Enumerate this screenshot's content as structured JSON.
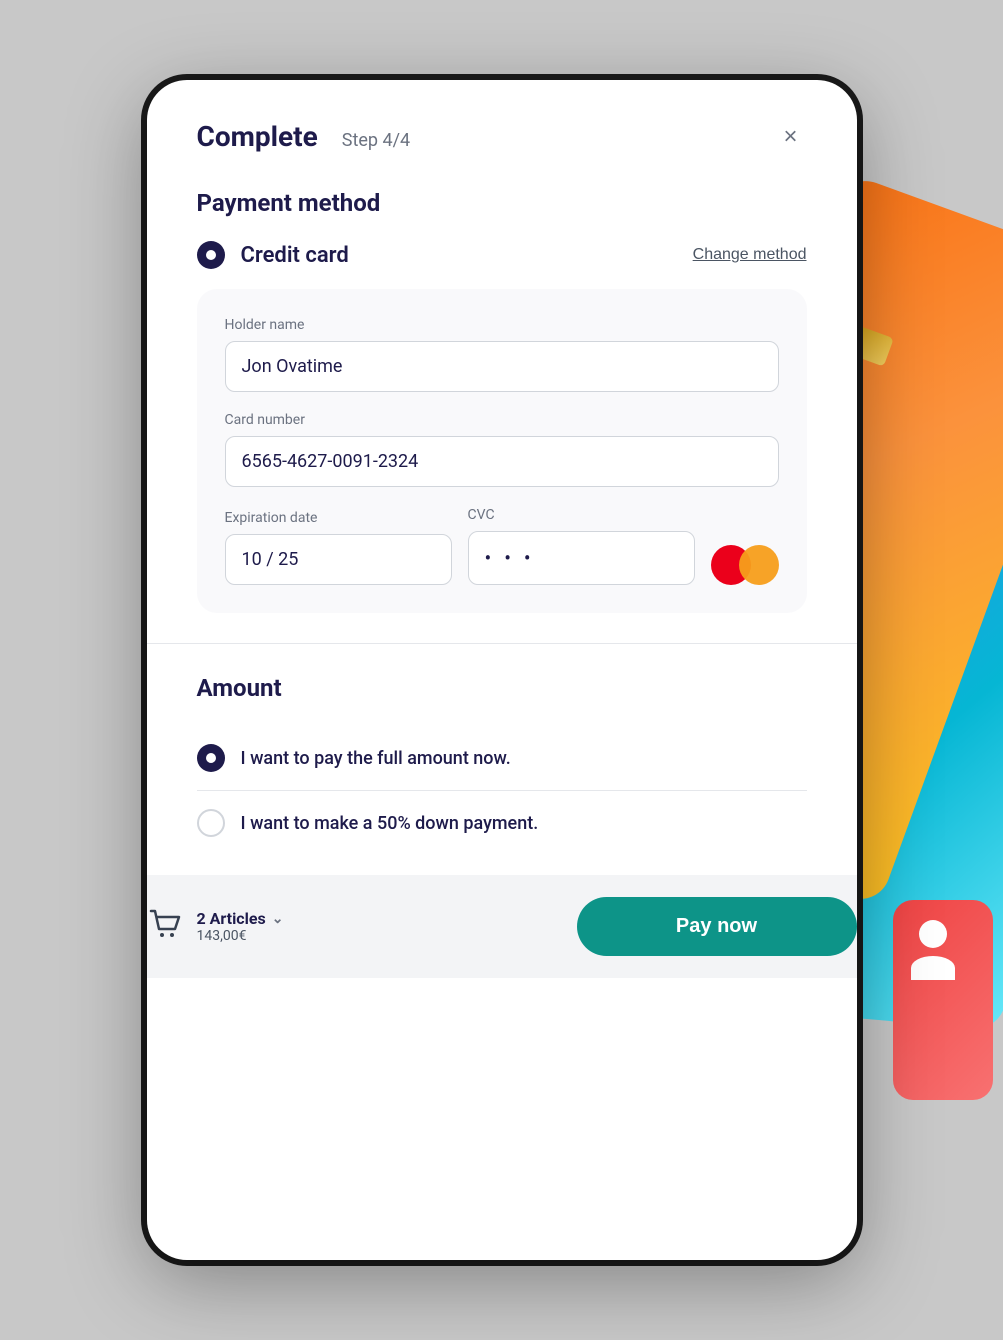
{
  "header": {
    "title": "Complete",
    "step": "Step 4/4",
    "close_label": "×"
  },
  "payment_method": {
    "section_title": "Payment method",
    "selected_method": "Credit card",
    "change_method_label": "Change method"
  },
  "card_form": {
    "holder_name_label": "Holder name",
    "holder_name_value": "Jon Ovatime",
    "card_number_label": "Card number",
    "card_number_value": "6565-4627-0091-2324",
    "expiration_label": "Expiration date",
    "expiration_value": "10 / 25",
    "cvc_label": "CVC",
    "cvc_value": "• • •"
  },
  "amount": {
    "section_title": "Amount",
    "option_full": "I want to pay the full amount now.",
    "option_partial": "I want to make a 50% down payment."
  },
  "footer": {
    "articles_count": "2 Articles",
    "total_price": "143,00€",
    "pay_button_label": "Pay now"
  }
}
